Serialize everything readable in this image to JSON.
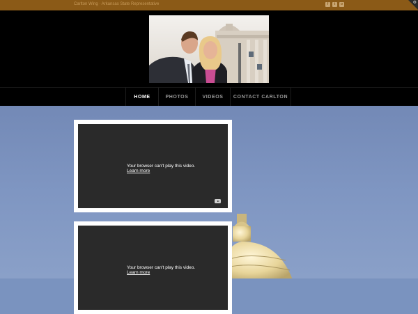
{
  "topbar": {
    "tagline": "Carlton Wing · Arkansas State Representative",
    "social": [
      {
        "icon": "facebook-icon",
        "glyph": "f"
      },
      {
        "icon": "twitter-icon",
        "glyph": "t"
      },
      {
        "icon": "instagram-icon",
        "glyph": "o"
      }
    ]
  },
  "nav": {
    "items": [
      {
        "label": "HOME",
        "active": true
      },
      {
        "label": "PHOTOS",
        "active": false
      },
      {
        "label": "VIDEOS",
        "active": false
      },
      {
        "label": "CONTACT CARLTON",
        "active": false
      }
    ]
  },
  "videos": [
    {
      "message": "Your browser can't play this video.",
      "link": "Learn more"
    },
    {
      "message": "Your browser can't play this video.",
      "link": "Learn more"
    }
  ],
  "colors": {
    "topbar": "#8b5a17",
    "accent": "#c8248a",
    "header": "#000000",
    "sky": "#7a93bf"
  }
}
